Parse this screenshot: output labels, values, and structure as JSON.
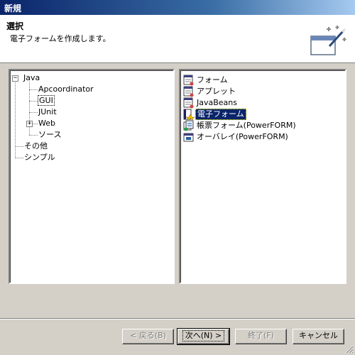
{
  "window": {
    "title": "新規"
  },
  "header": {
    "title": "選択",
    "description": "電子フォームを作成します。"
  },
  "tree": {
    "items": [
      {
        "label": "Java",
        "expander": "−"
      },
      {
        "label": "Apcoordinator"
      },
      {
        "label": "GUI"
      },
      {
        "label": "JUnit"
      },
      {
        "label": "Web",
        "expander": "+"
      },
      {
        "label": "ソース"
      },
      {
        "label": "その他"
      },
      {
        "label": "シンプル"
      }
    ]
  },
  "wizards": {
    "items": [
      {
        "label": "フォーム",
        "icon": "form-icon"
      },
      {
        "label": "アプレット",
        "icon": "applet-icon"
      },
      {
        "label": "JavaBeans",
        "icon": "javabeans-icon"
      },
      {
        "label": "電子フォーム",
        "icon": "electronic-form-icon",
        "selected": true
      },
      {
        "label": "帳票フォーム(PowerFORM)",
        "icon": "report-form-icon"
      },
      {
        "label": "オーバレイ(PowerFORM)",
        "icon": "overlay-icon"
      }
    ]
  },
  "buttons": {
    "back": "< 戻る(B)",
    "next": "次へ(N) >",
    "finish": "終了(F)",
    "cancel": "キャンセル"
  },
  "colors": {
    "selection": "#0a246a",
    "dialog_bg": "#d4d0c8"
  }
}
